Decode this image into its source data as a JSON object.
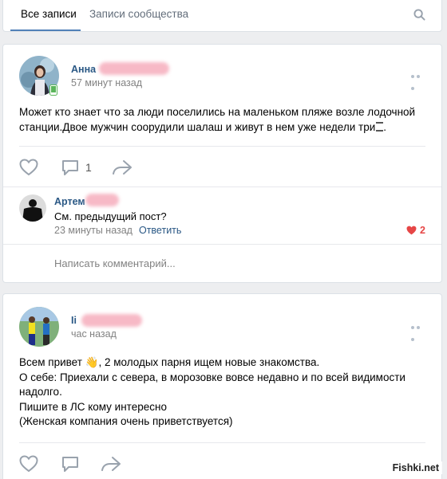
{
  "tabs": {
    "all_posts": "Все записи",
    "community_posts": "Записи сообщества",
    "search_icon": "search-icon"
  },
  "post1": {
    "author": "Анна",
    "time": "57 минут назад",
    "text_line1": "Может кто знает что за люди поселились на маленьком пляже возле лодочной",
    "text_line2": "станции.Двое мужчин соорудили шалаш и живут в нем уже недели три",
    "comments_count": "1",
    "comment": {
      "author": "Артем",
      "text": "См. предыдущий пост?",
      "time": "23 минуты назад",
      "reply_label": "Ответить",
      "likes": "2"
    },
    "write_placeholder": "Написать комментарий..."
  },
  "post2": {
    "author": "Ii",
    "time": "час назад",
    "lines": [
      "Всем привет 👋, 2 молодых парня ищем новые знакомства.",
      "О себе: Приехали с севера, в морозовке вовсе недавно и по всей видимости",
      "надолго.",
      "Пишите в ЛС кому интересно",
      "(Женская компания очень приветствуется)"
    ]
  },
  "watermark": "Fishki.net",
  "colors": {
    "link": "#2a5885",
    "accent": "#5181b8",
    "like_red": "#e64646",
    "background": "#edeef0"
  }
}
